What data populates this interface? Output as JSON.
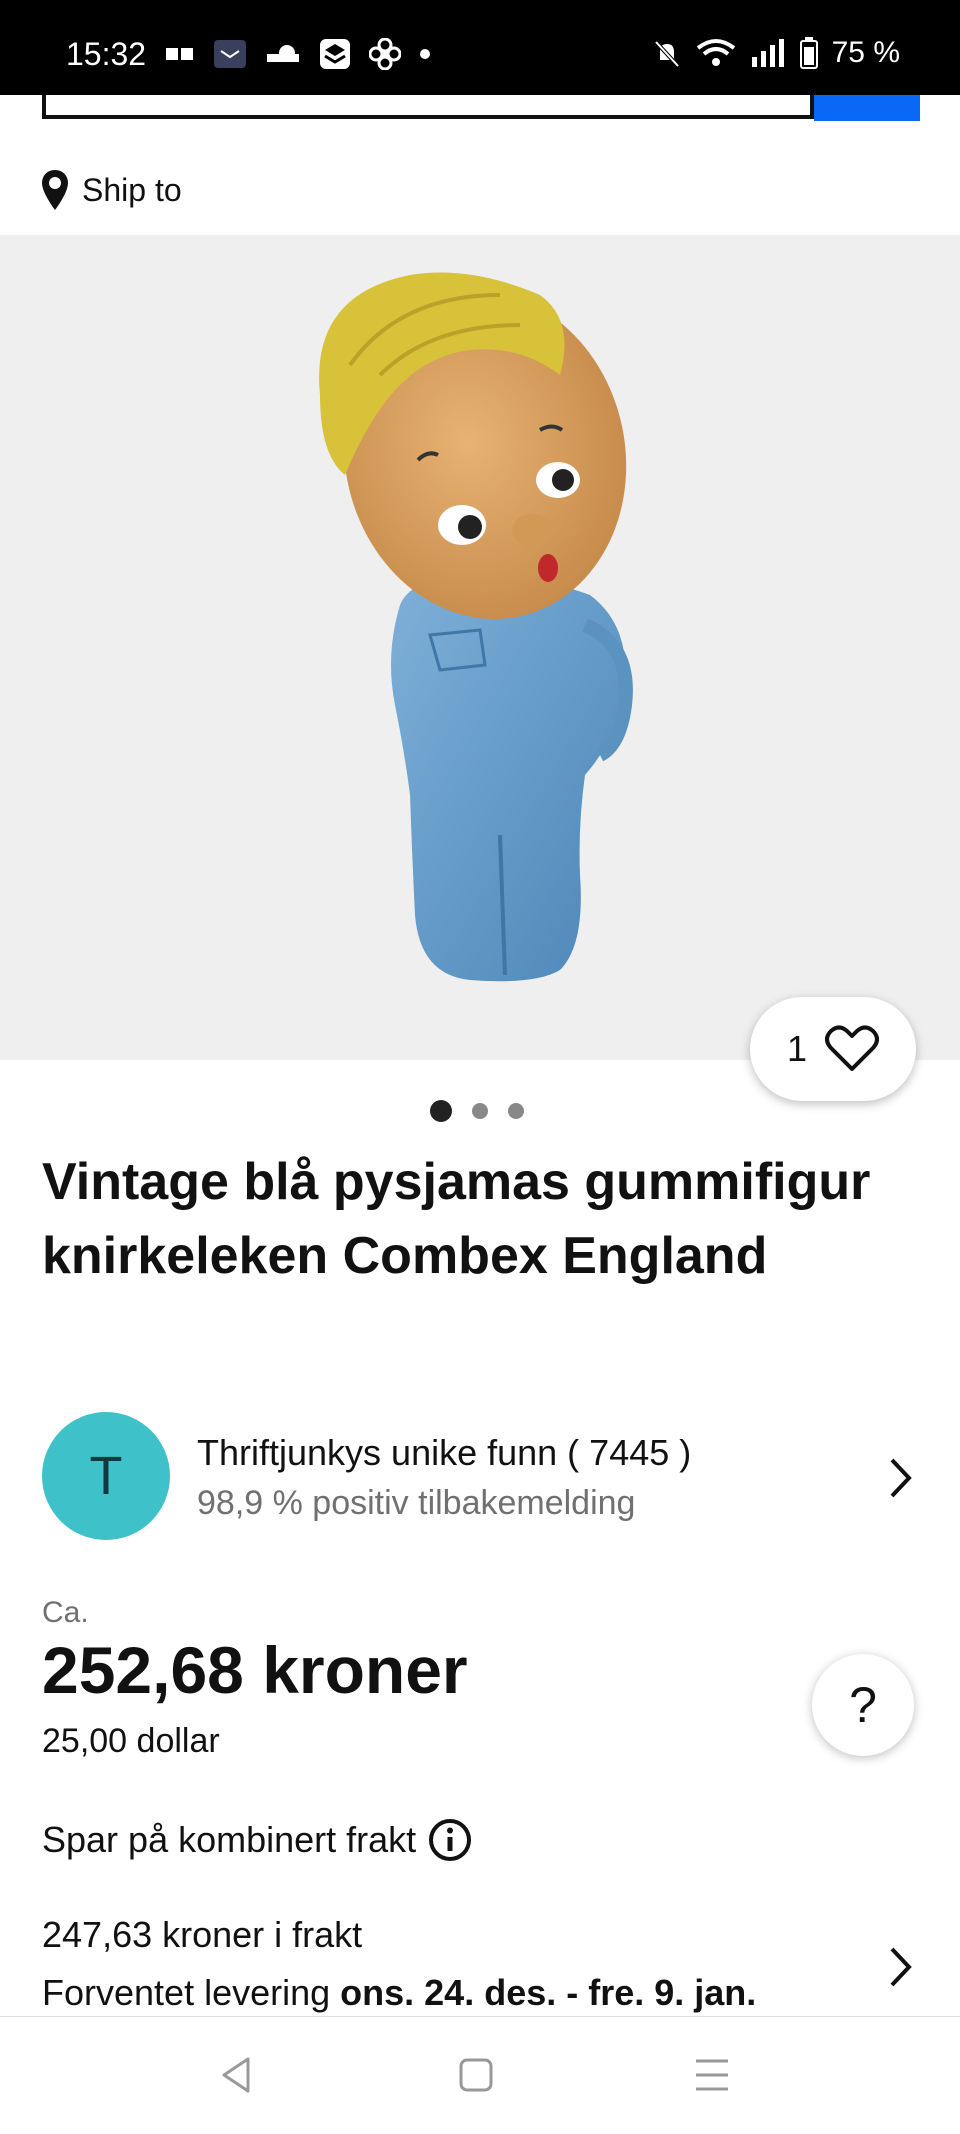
{
  "status_bar": {
    "time": "15:32",
    "battery": "75 %"
  },
  "ship_to": {
    "label": "Ship to"
  },
  "gallery": {
    "favorite_count": "1",
    "total_images": 3,
    "current_image": 1
  },
  "listing": {
    "title": "Vintage blå pysjamas gummifigur knirkeleken Combex England"
  },
  "seller": {
    "avatar_letter": "T",
    "name": "Thriftjunkys unike funn ( 7445 )",
    "feedback": "98,9 % positiv tilbakemelding"
  },
  "price": {
    "prefix": "Ca.",
    "amount": "252,68 kroner",
    "original": "25,00 dollar"
  },
  "help_label": "?",
  "shipping": {
    "combined_label": "Spar på kombinert frakt",
    "cost": "247,63 kroner i frakt",
    "delivery_prefix": "Forventet levering",
    "delivery_dates": "ons. 24. des. - fre. 9. jan."
  },
  "colors": {
    "accent": "#0968f6",
    "avatar": "#3fc1c9",
    "hero_bg": "#efefef"
  }
}
